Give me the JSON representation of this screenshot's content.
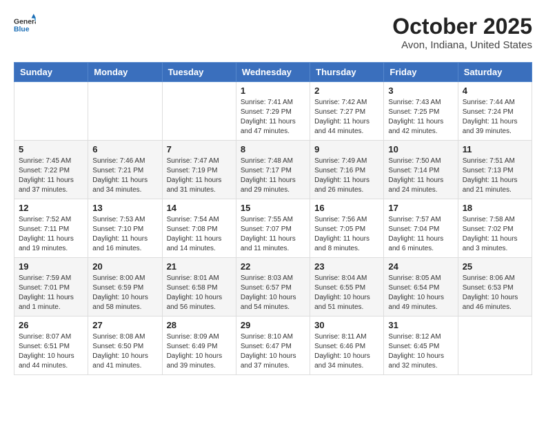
{
  "header": {
    "logo_general": "General",
    "logo_blue": "Blue",
    "month_title": "October 2025",
    "location": "Avon, Indiana, United States"
  },
  "weekdays": [
    "Sunday",
    "Monday",
    "Tuesday",
    "Wednesday",
    "Thursday",
    "Friday",
    "Saturday"
  ],
  "weeks": [
    [
      {
        "day": "",
        "info": ""
      },
      {
        "day": "",
        "info": ""
      },
      {
        "day": "",
        "info": ""
      },
      {
        "day": "1",
        "info": "Sunrise: 7:41 AM\nSunset: 7:29 PM\nDaylight: 11 hours and 47 minutes."
      },
      {
        "day": "2",
        "info": "Sunrise: 7:42 AM\nSunset: 7:27 PM\nDaylight: 11 hours and 44 minutes."
      },
      {
        "day": "3",
        "info": "Sunrise: 7:43 AM\nSunset: 7:25 PM\nDaylight: 11 hours and 42 minutes."
      },
      {
        "day": "4",
        "info": "Sunrise: 7:44 AM\nSunset: 7:24 PM\nDaylight: 11 hours and 39 minutes."
      }
    ],
    [
      {
        "day": "5",
        "info": "Sunrise: 7:45 AM\nSunset: 7:22 PM\nDaylight: 11 hours and 37 minutes."
      },
      {
        "day": "6",
        "info": "Sunrise: 7:46 AM\nSunset: 7:21 PM\nDaylight: 11 hours and 34 minutes."
      },
      {
        "day": "7",
        "info": "Sunrise: 7:47 AM\nSunset: 7:19 PM\nDaylight: 11 hours and 31 minutes."
      },
      {
        "day": "8",
        "info": "Sunrise: 7:48 AM\nSunset: 7:17 PM\nDaylight: 11 hours and 29 minutes."
      },
      {
        "day": "9",
        "info": "Sunrise: 7:49 AM\nSunset: 7:16 PM\nDaylight: 11 hours and 26 minutes."
      },
      {
        "day": "10",
        "info": "Sunrise: 7:50 AM\nSunset: 7:14 PM\nDaylight: 11 hours and 24 minutes."
      },
      {
        "day": "11",
        "info": "Sunrise: 7:51 AM\nSunset: 7:13 PM\nDaylight: 11 hours and 21 minutes."
      }
    ],
    [
      {
        "day": "12",
        "info": "Sunrise: 7:52 AM\nSunset: 7:11 PM\nDaylight: 11 hours and 19 minutes."
      },
      {
        "day": "13",
        "info": "Sunrise: 7:53 AM\nSunset: 7:10 PM\nDaylight: 11 hours and 16 minutes."
      },
      {
        "day": "14",
        "info": "Sunrise: 7:54 AM\nSunset: 7:08 PM\nDaylight: 11 hours and 14 minutes."
      },
      {
        "day": "15",
        "info": "Sunrise: 7:55 AM\nSunset: 7:07 PM\nDaylight: 11 hours and 11 minutes."
      },
      {
        "day": "16",
        "info": "Sunrise: 7:56 AM\nSunset: 7:05 PM\nDaylight: 11 hours and 8 minutes."
      },
      {
        "day": "17",
        "info": "Sunrise: 7:57 AM\nSunset: 7:04 PM\nDaylight: 11 hours and 6 minutes."
      },
      {
        "day": "18",
        "info": "Sunrise: 7:58 AM\nSunset: 7:02 PM\nDaylight: 11 hours and 3 minutes."
      }
    ],
    [
      {
        "day": "19",
        "info": "Sunrise: 7:59 AM\nSunset: 7:01 PM\nDaylight: 11 hours and 1 minute."
      },
      {
        "day": "20",
        "info": "Sunrise: 8:00 AM\nSunset: 6:59 PM\nDaylight: 10 hours and 58 minutes."
      },
      {
        "day": "21",
        "info": "Sunrise: 8:01 AM\nSunset: 6:58 PM\nDaylight: 10 hours and 56 minutes."
      },
      {
        "day": "22",
        "info": "Sunrise: 8:03 AM\nSunset: 6:57 PM\nDaylight: 10 hours and 54 minutes."
      },
      {
        "day": "23",
        "info": "Sunrise: 8:04 AM\nSunset: 6:55 PM\nDaylight: 10 hours and 51 minutes."
      },
      {
        "day": "24",
        "info": "Sunrise: 8:05 AM\nSunset: 6:54 PM\nDaylight: 10 hours and 49 minutes."
      },
      {
        "day": "25",
        "info": "Sunrise: 8:06 AM\nSunset: 6:53 PM\nDaylight: 10 hours and 46 minutes."
      }
    ],
    [
      {
        "day": "26",
        "info": "Sunrise: 8:07 AM\nSunset: 6:51 PM\nDaylight: 10 hours and 44 minutes."
      },
      {
        "day": "27",
        "info": "Sunrise: 8:08 AM\nSunset: 6:50 PM\nDaylight: 10 hours and 41 minutes."
      },
      {
        "day": "28",
        "info": "Sunrise: 8:09 AM\nSunset: 6:49 PM\nDaylight: 10 hours and 39 minutes."
      },
      {
        "day": "29",
        "info": "Sunrise: 8:10 AM\nSunset: 6:47 PM\nDaylight: 10 hours and 37 minutes."
      },
      {
        "day": "30",
        "info": "Sunrise: 8:11 AM\nSunset: 6:46 PM\nDaylight: 10 hours and 34 minutes."
      },
      {
        "day": "31",
        "info": "Sunrise: 8:12 AM\nSunset: 6:45 PM\nDaylight: 10 hours and 32 minutes."
      },
      {
        "day": "",
        "info": ""
      }
    ]
  ]
}
